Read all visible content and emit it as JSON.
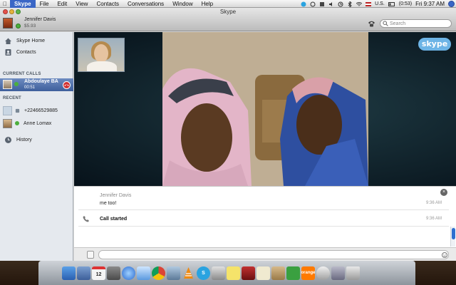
{
  "menubar": {
    "app_name": "Skype",
    "items": [
      "File",
      "Edit",
      "View",
      "Contacts",
      "Conversations",
      "Window",
      "Help"
    ],
    "locale": "U.S.",
    "battery": "(0:53)",
    "clock": "Fri 9:37 AM"
  },
  "window": {
    "title": "Skype",
    "user": {
      "name": "Jennifer Davis",
      "credit": "$5.93"
    },
    "search_placeholder": "Search"
  },
  "sidebar": {
    "skype_home": "Skype Home",
    "contacts": "Contacts",
    "current_calls_header": "CURRENT CALLS",
    "active_call": {
      "name": "Abdoulaye BA",
      "duration": "00:51"
    },
    "recent_header": "RECENT",
    "recent_items": [
      {
        "label": "+22466529885"
      },
      {
        "label": "Anne Lomax"
      }
    ],
    "history": "History"
  },
  "video": {
    "brand": "skype"
  },
  "chat": {
    "messages": [
      {
        "sender": "Jennifer Davis",
        "text": "me too!",
        "time": "9:36 AM"
      },
      {
        "event": "Call started",
        "time": "9:36 AM"
      }
    ],
    "input_value": ""
  },
  "dock": {
    "icons": [
      "finder-icon",
      "preview-icon",
      "calendar-icon",
      "calculator-icon",
      "itunes-icon",
      "mail-icon",
      "chrome-icon",
      "iphoto-icon",
      "vlc-icon",
      "skype-icon",
      "grapher-icon",
      "stickies-icon",
      "book-icon",
      "notes-icon",
      "archive-icon",
      "tex-icon",
      "orange-icon",
      "utility-icon",
      "preferences-icon",
      "trash-icon"
    ],
    "orange_label": "orange"
  },
  "colors": {
    "active_call_bg": "#3e5f9c",
    "status_online": "#4caf3d",
    "hangup": "#d23030",
    "skype_blue": "#6db4e6"
  }
}
